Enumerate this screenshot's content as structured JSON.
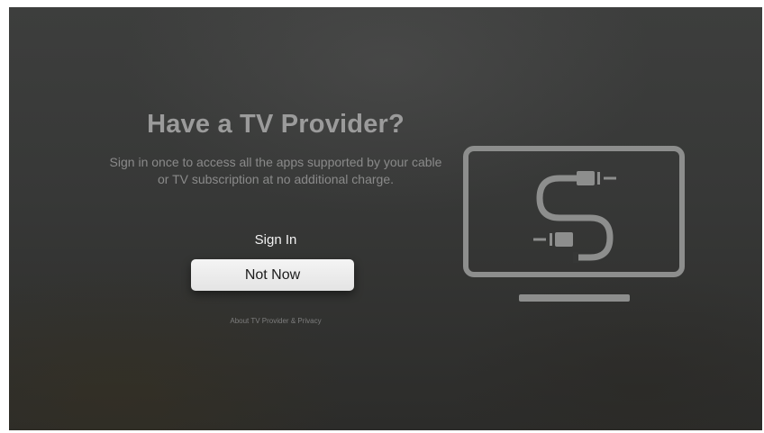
{
  "provider_prompt": {
    "title": "Have a TV Provider?",
    "description": "Sign in once to access all the apps supported by your cable or TV subscription at no additional charge.",
    "sign_in_label": "Sign In",
    "not_now_label": "Not Now",
    "privacy_link": "About TV Provider & Privacy"
  },
  "illustration": {
    "icon": "tv-with-cable-icon",
    "stroke_color": "#8d8e8d"
  },
  "colors": {
    "background": "#383938",
    "title_text": "#9b9b9b",
    "focused_button": "#ececec",
    "focused_button_text": "#1c1c1c"
  }
}
